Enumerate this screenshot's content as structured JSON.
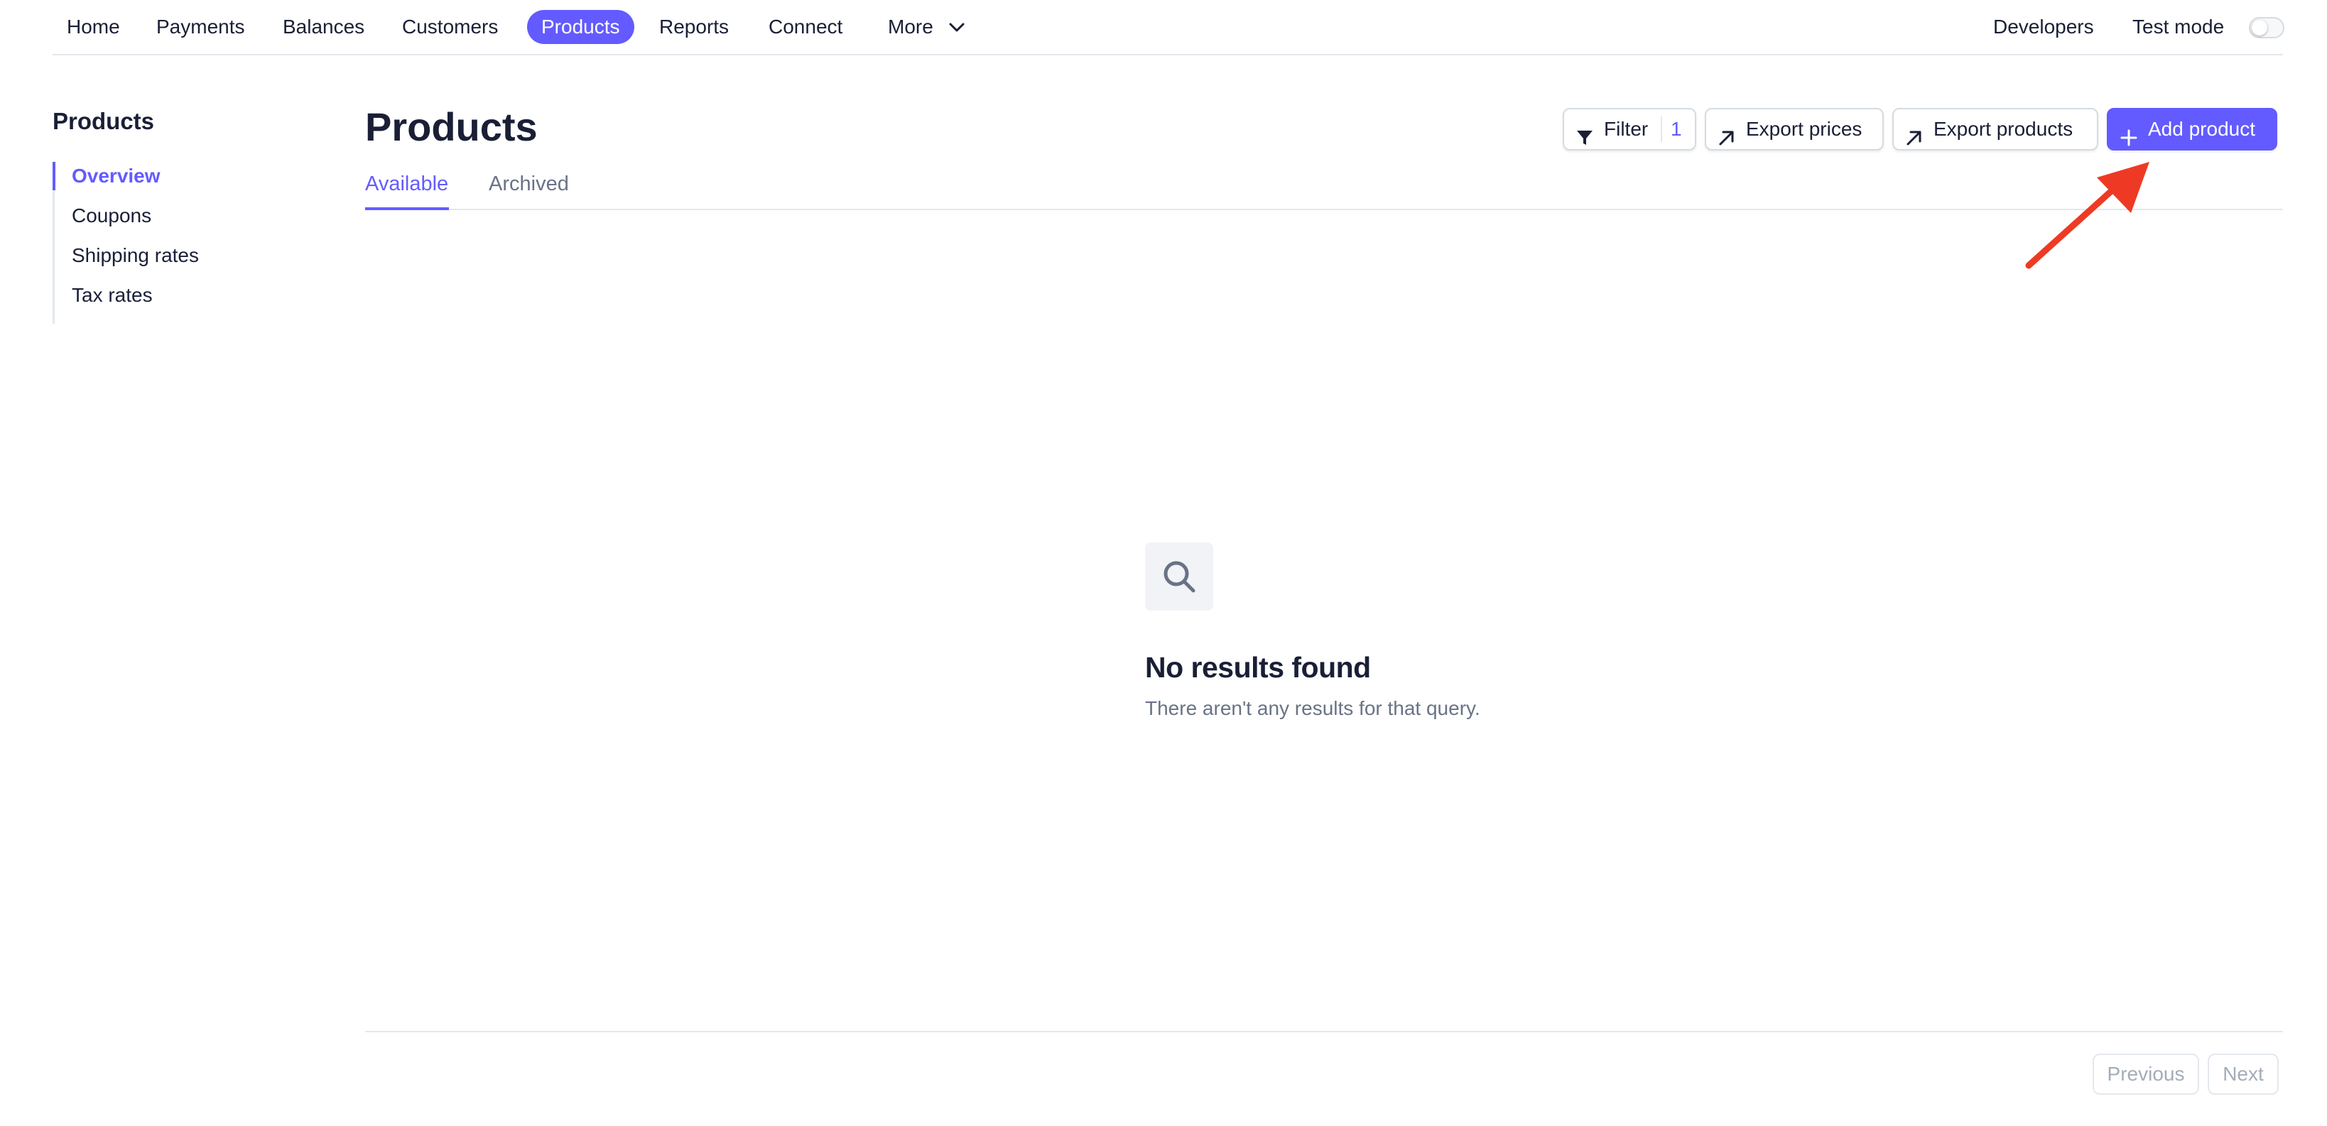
{
  "topnav": {
    "items": [
      {
        "label": "Home"
      },
      {
        "label": "Payments"
      },
      {
        "label": "Balances"
      },
      {
        "label": "Customers"
      },
      {
        "label": "Products",
        "active": true
      },
      {
        "label": "Reports"
      },
      {
        "label": "Connect"
      },
      {
        "label": "More"
      }
    ],
    "developers_label": "Developers",
    "test_mode_label": "Test mode",
    "test_mode_on": false
  },
  "sidebar": {
    "title": "Products",
    "items": [
      {
        "label": "Overview",
        "active": true
      },
      {
        "label": "Coupons"
      },
      {
        "label": "Shipping rates"
      },
      {
        "label": "Tax rates"
      }
    ]
  },
  "header": {
    "title": "Products",
    "filter_label": "Filter",
    "filter_count": "1",
    "export_prices_label": "Export prices",
    "export_products_label": "Export products",
    "add_product_label": "Add product"
  },
  "tabs": [
    {
      "label": "Available",
      "active": true
    },
    {
      "label": "Archived"
    }
  ],
  "empty_state": {
    "icon": "search-icon",
    "title": "No results found",
    "subtitle": "There aren't any results for that query."
  },
  "pagination": {
    "previous_label": "Previous",
    "next_label": "Next"
  },
  "colors": {
    "accent": "#635bff",
    "annotation_arrow": "#ee3a24"
  }
}
